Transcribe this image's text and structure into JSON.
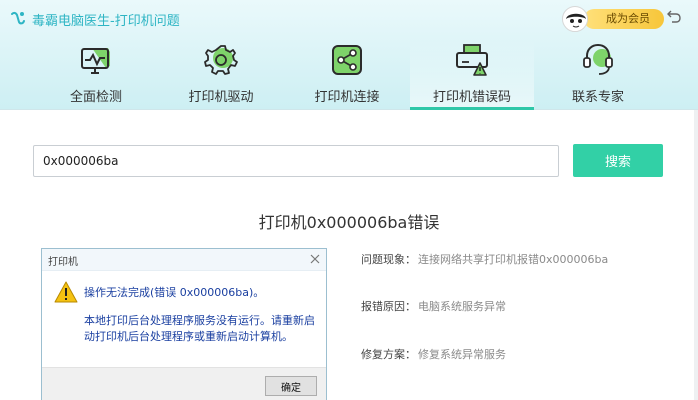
{
  "app": {
    "title": "毒霸电脑医生-打印机问题"
  },
  "member": {
    "label": "成为会员"
  },
  "tabs": [
    {
      "label": "全面检测",
      "icon": "monitor-check-icon",
      "active": false
    },
    {
      "label": "打印机驱动",
      "icon": "gear-driver-icon",
      "active": false
    },
    {
      "label": "打印机连接",
      "icon": "share-connect-icon",
      "active": false
    },
    {
      "label": "打印机错误码",
      "icon": "printer-warning-icon",
      "active": true
    },
    {
      "label": "联系专家",
      "icon": "headset-icon",
      "active": false
    }
  ],
  "search": {
    "value": "0x000006ba",
    "button_label": "搜索"
  },
  "result": {
    "title": "打印机0x000006ba错误"
  },
  "dialog": {
    "title": "打印机",
    "main_message": "操作无法完成(错误 0x000006ba)。",
    "detail": "本地打印后台处理程序服务没有运行。请重新启动打印机后台处理程序或重新启动计算机。",
    "ok_label": "确定"
  },
  "info": {
    "symptom_label": "问题现象：",
    "symptom_value": "连接网络共享打印机报错0x000006ba",
    "cause_label": "报错原因：",
    "cause_value": "电脑系统服务异常",
    "fix_label": "修复方案：",
    "fix_value": "修复系统异常服务"
  },
  "colors": {
    "accent": "#32d0a6",
    "title_teal": "#2eb5c4",
    "dialog_text": "#1a3fa0"
  }
}
